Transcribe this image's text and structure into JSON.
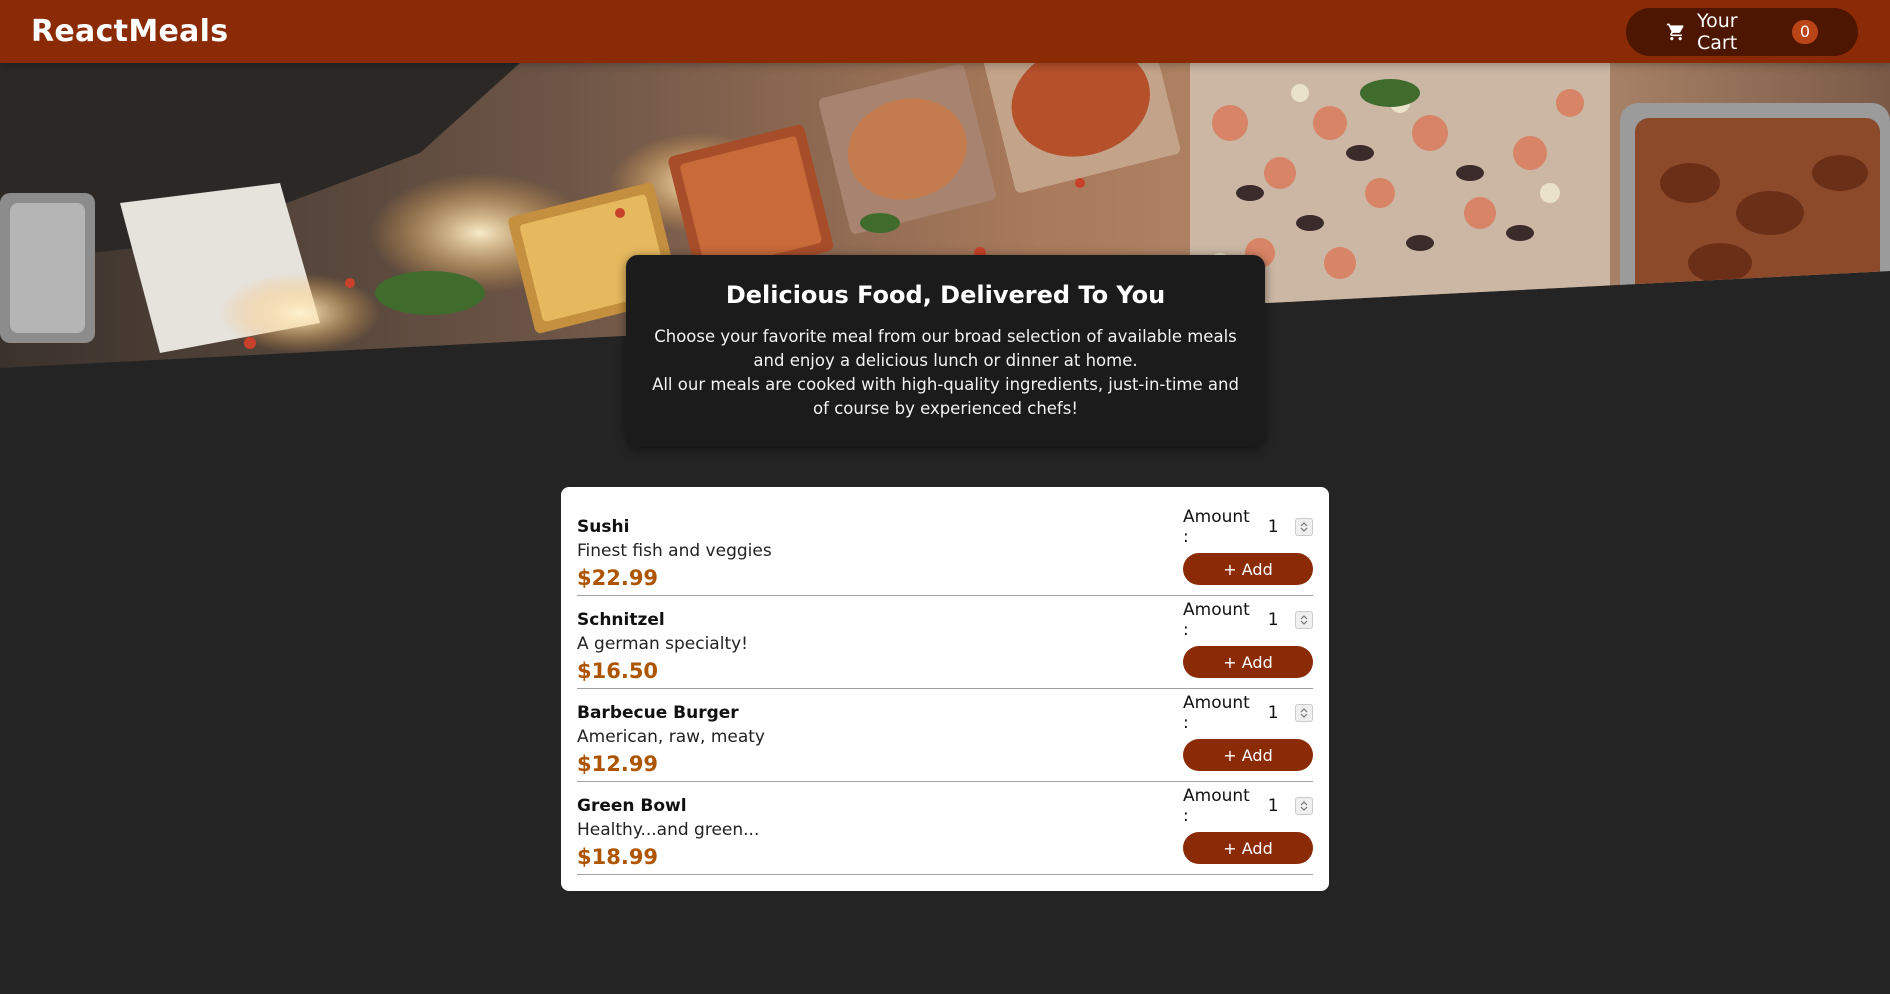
{
  "header": {
    "logo": "ReactMeals",
    "cart": {
      "label": "Your Cart",
      "count": "0",
      "icon": "cart-icon"
    }
  },
  "hero": {
    "image": "food-buffet-photo"
  },
  "summary": {
    "title": "Delicious Food, Delivered To You",
    "paragraph1": "Choose your favorite meal from our broad selection of available meals and enjoy a delicious lunch or dinner at home.",
    "paragraph2": "All our meals are cooked with high-quality ingredients, just-in-time and of course by experienced chefs!"
  },
  "meals": [
    {
      "name": "Sushi",
      "description": "Finest fish and veggies",
      "price": "$22.99",
      "amount_label": "Amount :",
      "amount": "1",
      "add_label": "+ Add"
    },
    {
      "name": "Schnitzel",
      "description": "A german specialty!",
      "price": "$16.50",
      "amount_label": "Amount :",
      "amount": "1",
      "add_label": "+ Add"
    },
    {
      "name": "Barbecue Burger",
      "description": "American, raw, meaty",
      "price": "$12.99",
      "amount_label": "Amount :",
      "amount": "1",
      "add_label": "+ Add"
    },
    {
      "name": "Green Bowl",
      "description": "Healthy...and green...",
      "price": "$18.99",
      "amount_label": "Amount :",
      "amount": "1",
      "add_label": "+ Add"
    }
  ],
  "colors": {
    "header": "#8a2b06",
    "cart_button": "#4d1601",
    "badge": "#b94517",
    "background": "#242424",
    "price": "#ad5502"
  }
}
